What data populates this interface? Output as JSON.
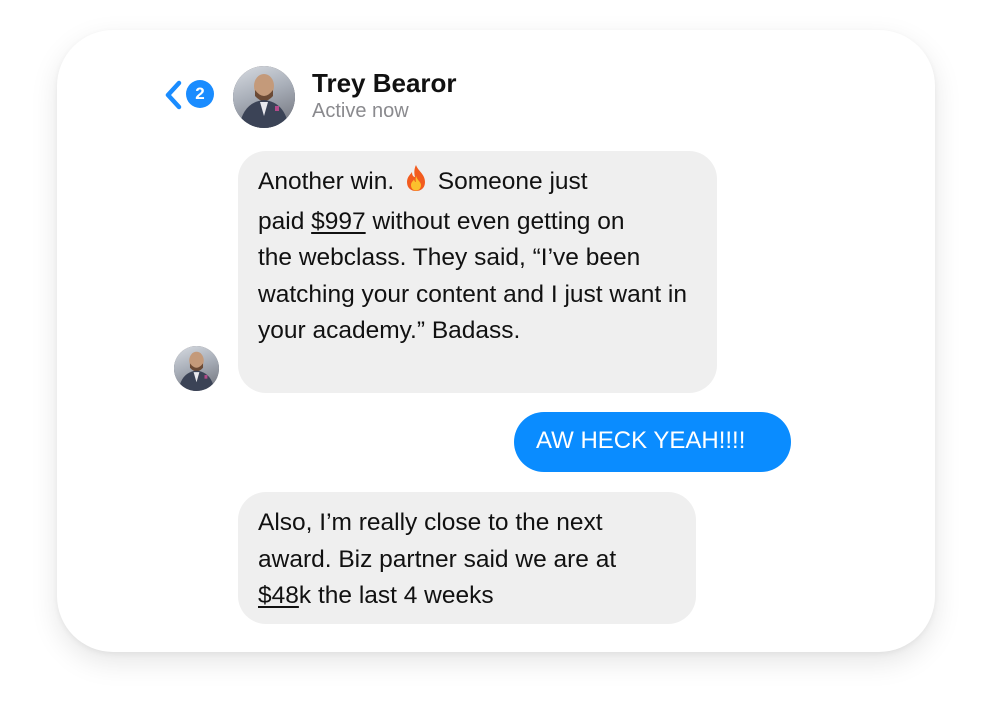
{
  "header": {
    "back_badge_count": "2",
    "contact_name": "Trey Bearor",
    "status": "Active now"
  },
  "messages": [
    {
      "direction": "incoming",
      "line1_pre": "Another win. ",
      "line1_post": " Someone just",
      "paid": "paid ",
      "amount": "$997",
      "line2_post": " without even getting on",
      "rest": "the webclass. They said, “I’ve been watching your content and I just want in your academy.” Badass."
    },
    {
      "direction": "outgoing",
      "text": "AW HECK YEAH!!!!"
    },
    {
      "direction": "incoming",
      "pre": "Also, I’m really close to the next award. Biz partner said we are at ",
      "amount": "$48",
      "post": "k the last 4 weeks"
    }
  ],
  "colors": {
    "accent": "#0a8cff",
    "incoming_bubble": "#efefef",
    "status_text": "#8a8a8e"
  },
  "icons": [
    "chevron-left-icon",
    "fire-emoji-icon"
  ]
}
